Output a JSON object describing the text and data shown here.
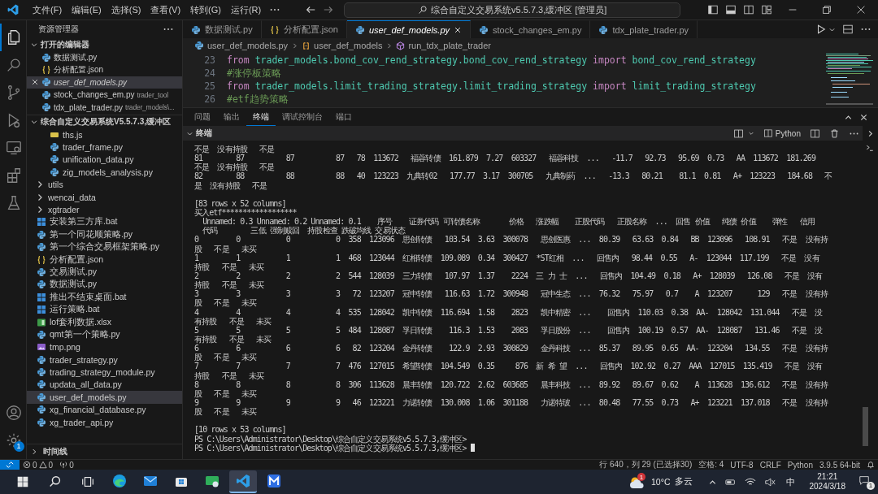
{
  "title_bar": {
    "menus": [
      "文件(F)",
      "编辑(E)",
      "选择(S)",
      "查看(V)",
      "转到(G)",
      "运行(R)"
    ],
    "command_center": "综合自定义交易系统v5.5.7.3,缓冲区 [管理员]"
  },
  "activity_bar": {
    "items": [
      {
        "kind": "explorer",
        "selected": true
      },
      {
        "kind": "search",
        "selected": false
      },
      {
        "kind": "source-control",
        "selected": false
      },
      {
        "kind": "run",
        "selected": false
      },
      {
        "kind": "remote",
        "selected": false
      },
      {
        "kind": "extensions",
        "selected": false
      },
      {
        "kind": "testing",
        "selected": false
      }
    ],
    "settings_badge": "1"
  },
  "sidebar": {
    "title": "资源管理器",
    "open_editors": {
      "label": "打开的编辑器",
      "expanded": true,
      "items": [
        {
          "name": "数据测试.py",
          "kind": "py",
          "selected": false,
          "preview": false
        },
        {
          "name": "分析配置.json",
          "kind": "json",
          "selected": false,
          "preview": false
        },
        {
          "name": "user_def_models.py",
          "kind": "py",
          "selected": true,
          "preview": true
        },
        {
          "name": "stock_changes_em.py",
          "kind": "py",
          "selected": false,
          "preview": false,
          "path": "trader_tool"
        },
        {
          "name": "tdx_plate_trader.py",
          "kind": "py",
          "selected": false,
          "preview": false,
          "path": "trader_models\\..."
        }
      ]
    },
    "workspace": {
      "label": "综合自定义交易系统V5.5.7.3,缓冲区",
      "expanded": true,
      "partial_folder_children": [
        {
          "name": "ths.js",
          "kind": "js",
          "selected": false
        },
        {
          "name": "trader_frame.py",
          "kind": "py",
          "selected": false
        },
        {
          "name": "unification_data.py",
          "kind": "py",
          "selected": false
        },
        {
          "name": "zig_models_analysis.py",
          "kind": "py",
          "selected": false
        }
      ],
      "items": [
        {
          "name": "utils",
          "kind": "folder",
          "selected": false
        },
        {
          "name": "wencai_data",
          "kind": "folder",
          "selected": false
        },
        {
          "name": "xgtrader",
          "kind": "folder",
          "selected": false
        },
        {
          "name": "安装第三方库.bat",
          "kind": "bat",
          "selected": false
        },
        {
          "name": "第一个同花顺策略.py",
          "kind": "py",
          "selected": false
        },
        {
          "name": "第一个综合交易框架策略.py",
          "kind": "py",
          "selected": false
        },
        {
          "name": "分析配置.json",
          "kind": "json",
          "selected": false
        },
        {
          "name": "交易测试.py",
          "kind": "py",
          "selected": false
        },
        {
          "name": "数据测试.py",
          "kind": "py",
          "selected": false
        },
        {
          "name": "推出不结束桌面.bat",
          "kind": "bat",
          "selected": false
        },
        {
          "name": "运行策略.bat",
          "kind": "bat",
          "selected": false
        },
        {
          "name": "lof套利数据.xlsx",
          "kind": "xlsx",
          "selected": false
        },
        {
          "name": "qmt第一个策略.py",
          "kind": "py",
          "selected": false
        },
        {
          "name": "tmp.png",
          "kind": "png",
          "selected": false
        },
        {
          "name": "trader_strategy.py",
          "kind": "py",
          "selected": false
        },
        {
          "name": "trading_strategy_module.py",
          "kind": "py",
          "selected": false
        },
        {
          "name": "updata_all_data.py",
          "kind": "py",
          "selected": false
        },
        {
          "name": "user_def_models.py",
          "kind": "py",
          "selected": true
        },
        {
          "name": "xg_financial_database.py",
          "kind": "py",
          "selected": false
        },
        {
          "name": "xg_trader_api.py",
          "kind": "py",
          "selected": false
        }
      ]
    },
    "timeline": {
      "label": "时间线",
      "expanded": false
    }
  },
  "editor": {
    "tabs": [
      {
        "label": "数据测试.py",
        "kind": "py",
        "selected": false,
        "preview": false
      },
      {
        "label": "分析配置.json",
        "kind": "json",
        "selected": false,
        "preview": false
      },
      {
        "label": "user_def_models.py",
        "kind": "py",
        "selected": true,
        "preview": true
      },
      {
        "label": "stock_changes_em.py",
        "kind": "py",
        "selected": false,
        "preview": false
      },
      {
        "label": "tdx_plate_trader.py",
        "kind": "py",
        "selected": false,
        "preview": false
      }
    ],
    "breadcrumbs": [
      {
        "label": "user_def_models.py",
        "kind": "file"
      },
      {
        "label": "user_def_models",
        "kind": "namespace"
      },
      {
        "label": "run_tdx_plate_trader",
        "kind": "method"
      }
    ],
    "code": [
      {
        "number": "23",
        "tokens": [
          {
            "kind": "keyword",
            "text": "from"
          },
          {
            "kind": "module",
            "text": "trader_models.bond_cov_rend_strategy.bond_cov_rend_strategy"
          },
          {
            "kind": "keyword",
            "text": "import"
          },
          {
            "kind": "module",
            "text": "bond_cov_rend_strategy"
          }
        ]
      },
      {
        "number": "24",
        "tokens": [
          {
            "kind": "comment",
            "text": "#涨停板策略"
          }
        ]
      },
      {
        "number": "25",
        "tokens": [
          {
            "kind": "keyword",
            "text": "from"
          },
          {
            "kind": "module",
            "text": "trader_models.limit_trading_strategy.limit_trading_strategy"
          },
          {
            "kind": "keyword",
            "text": "import"
          },
          {
            "kind": "module",
            "text": "limit_trading_strategy"
          }
        ]
      },
      {
        "number": "26",
        "tokens": [
          {
            "kind": "comment",
            "text": "#etf趋势策略"
          }
        ]
      }
    ]
  },
  "panel": {
    "tabs": [
      {
        "label": "问题",
        "selected": false
      },
      {
        "label": "输出",
        "selected": false
      },
      {
        "label": "终端",
        "selected": true
      },
      {
        "label": "调试控制台",
        "selected": false
      },
      {
        "label": "端口",
        "selected": false
      }
    ],
    "terminal_header": "终端",
    "profile": "Python",
    "cursor": true,
    "blocks": [
      [
        "不是  没有持股   不是",
        "81        87          87          87   78  113672   福蓉转债  161.879  7.27  603327   福蓉科技  ...   -11.7   92.73   95.69  0.73   AA  113672  181.269",
        "不是  没有持股   不是",
        "82        88          88          88   40  123223  九典转02   177.77  3.17  300705   九典制药  ...   -13.3   80.21    81.1  0.81   A+  123223   184.68   不",
        "是  没有持股   不是"
      ],
      [
        "[83 rows x 52 columns]",
        "买入etf******************",
        "  Unnamed: 0.3 Unnamed: 0.2 Unnamed: 0.1    序号    证券代码 可转债名称       价格   涨跌幅    正股代码   正股名称  ...  回售 价值   纯债 价值    弹性   信用",
        "  代码        三低 强制赎回  持股检查 跌破均线 交易状态",
        "0         0           0           0  358  123096  思创转债   103.54  3.63  300078   思创医惠  ...  80.39   63.63  0.84   BB  123096   108.91   不是  没有持",
        "股   不是   未买",
        "1         1           1           1  468  123044  红相转债  109.089  0.34  300427  *ST红相  ...   回售内   98.44  0.55   A-  123044  117.199   不是  没有",
        "持股   不是   未买",
        "2         2           2           2  544  128039  三力转债   107.97  1.37    2224  三 力 士  ...   回售内  104.49  0.18   A+  128039   126.08   不是  没有",
        "持股   不是   未买",
        "3         3           3           3   72  123207  冠中转债   116.63  1.72  300948   冠中生态  ...  76.32   75.97   0.7    A  123207      129   不是  没有持",
        "股   不是   未买",
        "4         4           4           4  535  128042  凯中转债  116.694  1.58    2823   凯中精密  ...    回售内  110.03  0.38  AA-  128042  131.044   不是  没",
        "有持股   不是   未买",
        "5         5           5           5  484  128087  孚日转债    116.3  1.53    2083   孚日股份  ...    回售内  100.19  0.57  AA-  128087   131.46   不是  没",
        "有持股   不是   未买",
        "6         6           6           6   82  123204  金丹转债    122.9  2.93  300829   金丹科技  ...  85.37   89.95  0.65  AA-  123204   134.55   不是  没有持",
        "股   不是   未买",
        "7         7           7           7  476  127015  希望转债  104.549  0.35     876  新 希 望  ...   回售内  102.92  0.27  AAA  127015  135.419   不是  没有",
        "持股   不是   未买",
        "8         8           8           8  306  113628  晨丰转债  120.722  2.62  603685   晨丰科技  ...  89.92   89.67  0.62    A  113628  136.612   不是  没有持",
        "股   不是   未买",
        "9         9           9           9   46  123221  力诺转债  130.008  1.06  301188   力诺特玻  ...  80.48   77.55  0.73   A+  123221  137.018   不是  没有持",
        "股   不是   未买"
      ],
      [
        "[10 rows x 53 columns]",
        "PS C:\\Users\\Administrator\\Desktop\\综合自定义交易系统v5.5.7.3,缓冲区>",
        "PS C:\\Users\\Administrator\\Desktop\\综合自定义交易系统v5.5.7.3,缓冲区>"
      ]
    ]
  },
  "status_bar": {
    "errors": "0",
    "warnings": "0",
    "ports": "0",
    "items": [
      "行 640，列 29 (已选择30)",
      "空格: 4",
      "UTF-8",
      "CRLF",
      "Python",
      "3.9.5 64-bit"
    ]
  },
  "taskbar": {
    "apps": [
      {
        "kind": "edge",
        "selected": false
      },
      {
        "kind": "mail",
        "selected": false
      },
      {
        "kind": "store",
        "selected": false
      },
      {
        "kind": "monitor",
        "selected": false
      },
      {
        "kind": "vscode",
        "selected": true
      },
      {
        "kind": "app",
        "selected": false
      }
    ],
    "weather": {
      "temperature": "10°C",
      "condition": "多云",
      "badge": "1"
    },
    "ime": "中",
    "time": "21:21",
    "date": "2024/3/18",
    "notifications": "1"
  }
}
